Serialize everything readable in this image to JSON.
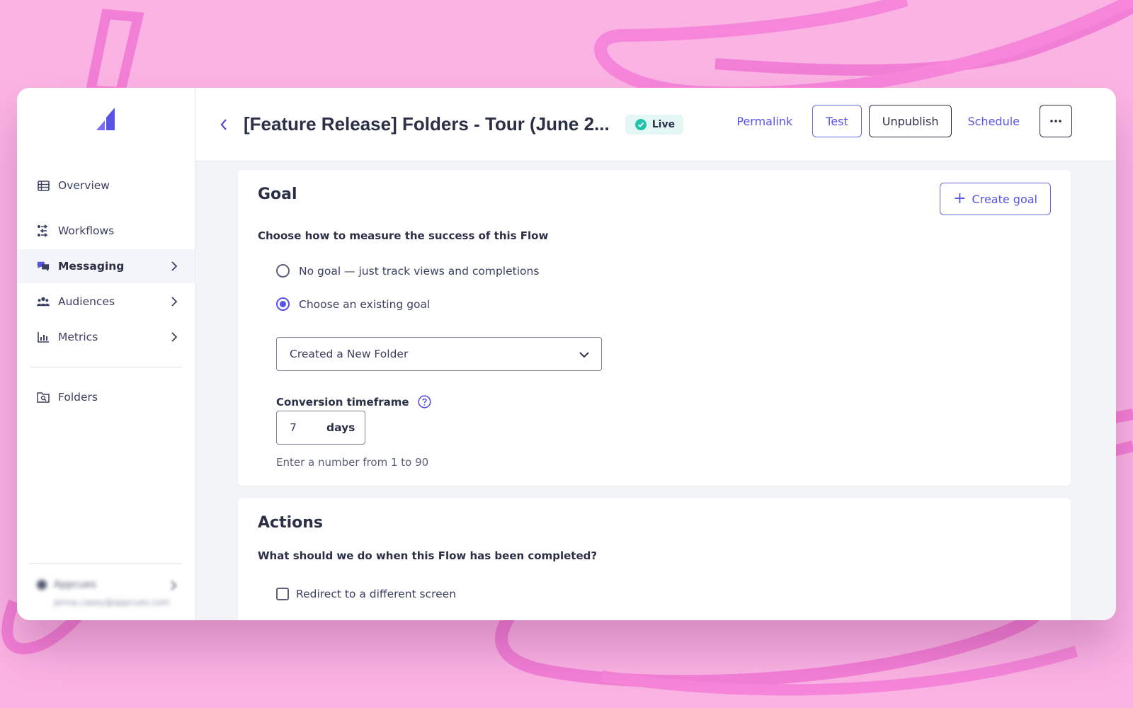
{
  "sidebar": {
    "items": [
      {
        "label": "Overview",
        "icon": "table-icon"
      },
      {
        "label": "Workflows",
        "icon": "workflow-icon"
      },
      {
        "label": "Messaging",
        "icon": "chat-icon",
        "active": true
      },
      {
        "label": "Audiences",
        "icon": "users-icon"
      },
      {
        "label": "Metrics",
        "icon": "bar-chart-icon"
      },
      {
        "label": "Folders",
        "icon": "folder-search-icon"
      }
    ],
    "user": {
      "name": "Appcues",
      "email": "jenna.casey@appcues.com"
    }
  },
  "header": {
    "title": "[Feature Release] Folders - Tour (June 2...",
    "status": "Live",
    "permalink": "Permalink",
    "test": "Test",
    "unpublish": "Unpublish",
    "schedule": "Schedule",
    "more": "•••"
  },
  "goal": {
    "title": "Goal",
    "create_button": "Create goal",
    "question": "Choose how to measure the success of this Flow",
    "options": [
      {
        "label": "No goal — just track views and completions",
        "selected": false
      },
      {
        "label": "Choose an existing goal",
        "selected": true
      }
    ],
    "selected_goal": "Created a New Folder",
    "timeframe_label": "Conversion timeframe",
    "timeframe_value": "7",
    "timeframe_unit": "days",
    "timeframe_hint": "Enter a number from 1 to 90"
  },
  "actions": {
    "title": "Actions",
    "question": "What should we do when this Flow has been completed?",
    "options": [
      {
        "label": "Redirect to a different screen",
        "checked": false
      }
    ]
  },
  "colors": {
    "accent": "#5653e6",
    "background": "#fbb3e4",
    "live_badge": "#e4f7f4",
    "live_check": "#20c4ac"
  }
}
